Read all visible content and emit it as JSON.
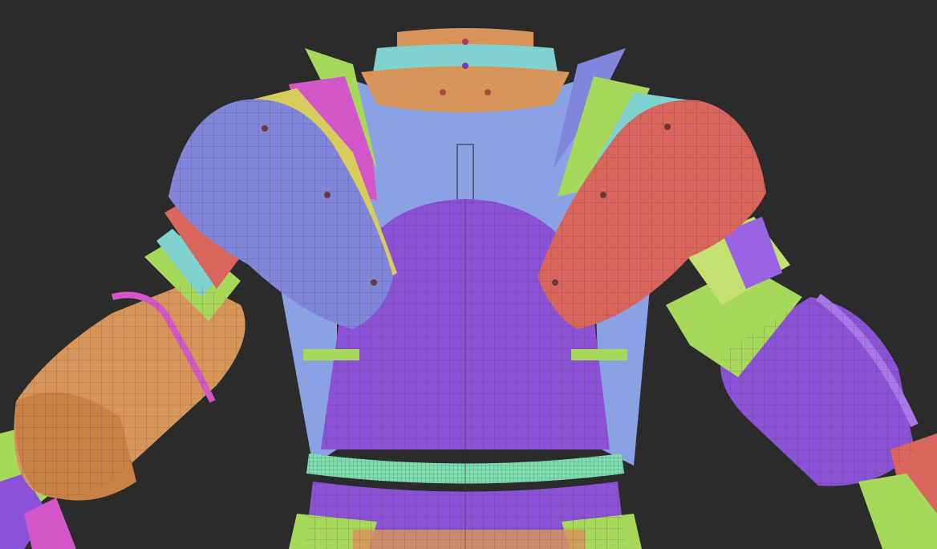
{
  "scene": {
    "background": "#2b2b2b",
    "palette": {
      "orange": "#d8955a",
      "orange_dark": "#b9743f",
      "cyan": "#7fd2d0",
      "blue": "#7f86db",
      "blue_light": "#8aa2e4",
      "purple": "#8a52d6",
      "purple_light": "#9a62e4",
      "magenta": "#d357c8",
      "yellow": "#d8cc5c",
      "lime": "#a6d85a",
      "red": "#d9665c",
      "mint": "#7ee0b0",
      "wire": "#5a2a2a"
    }
  }
}
